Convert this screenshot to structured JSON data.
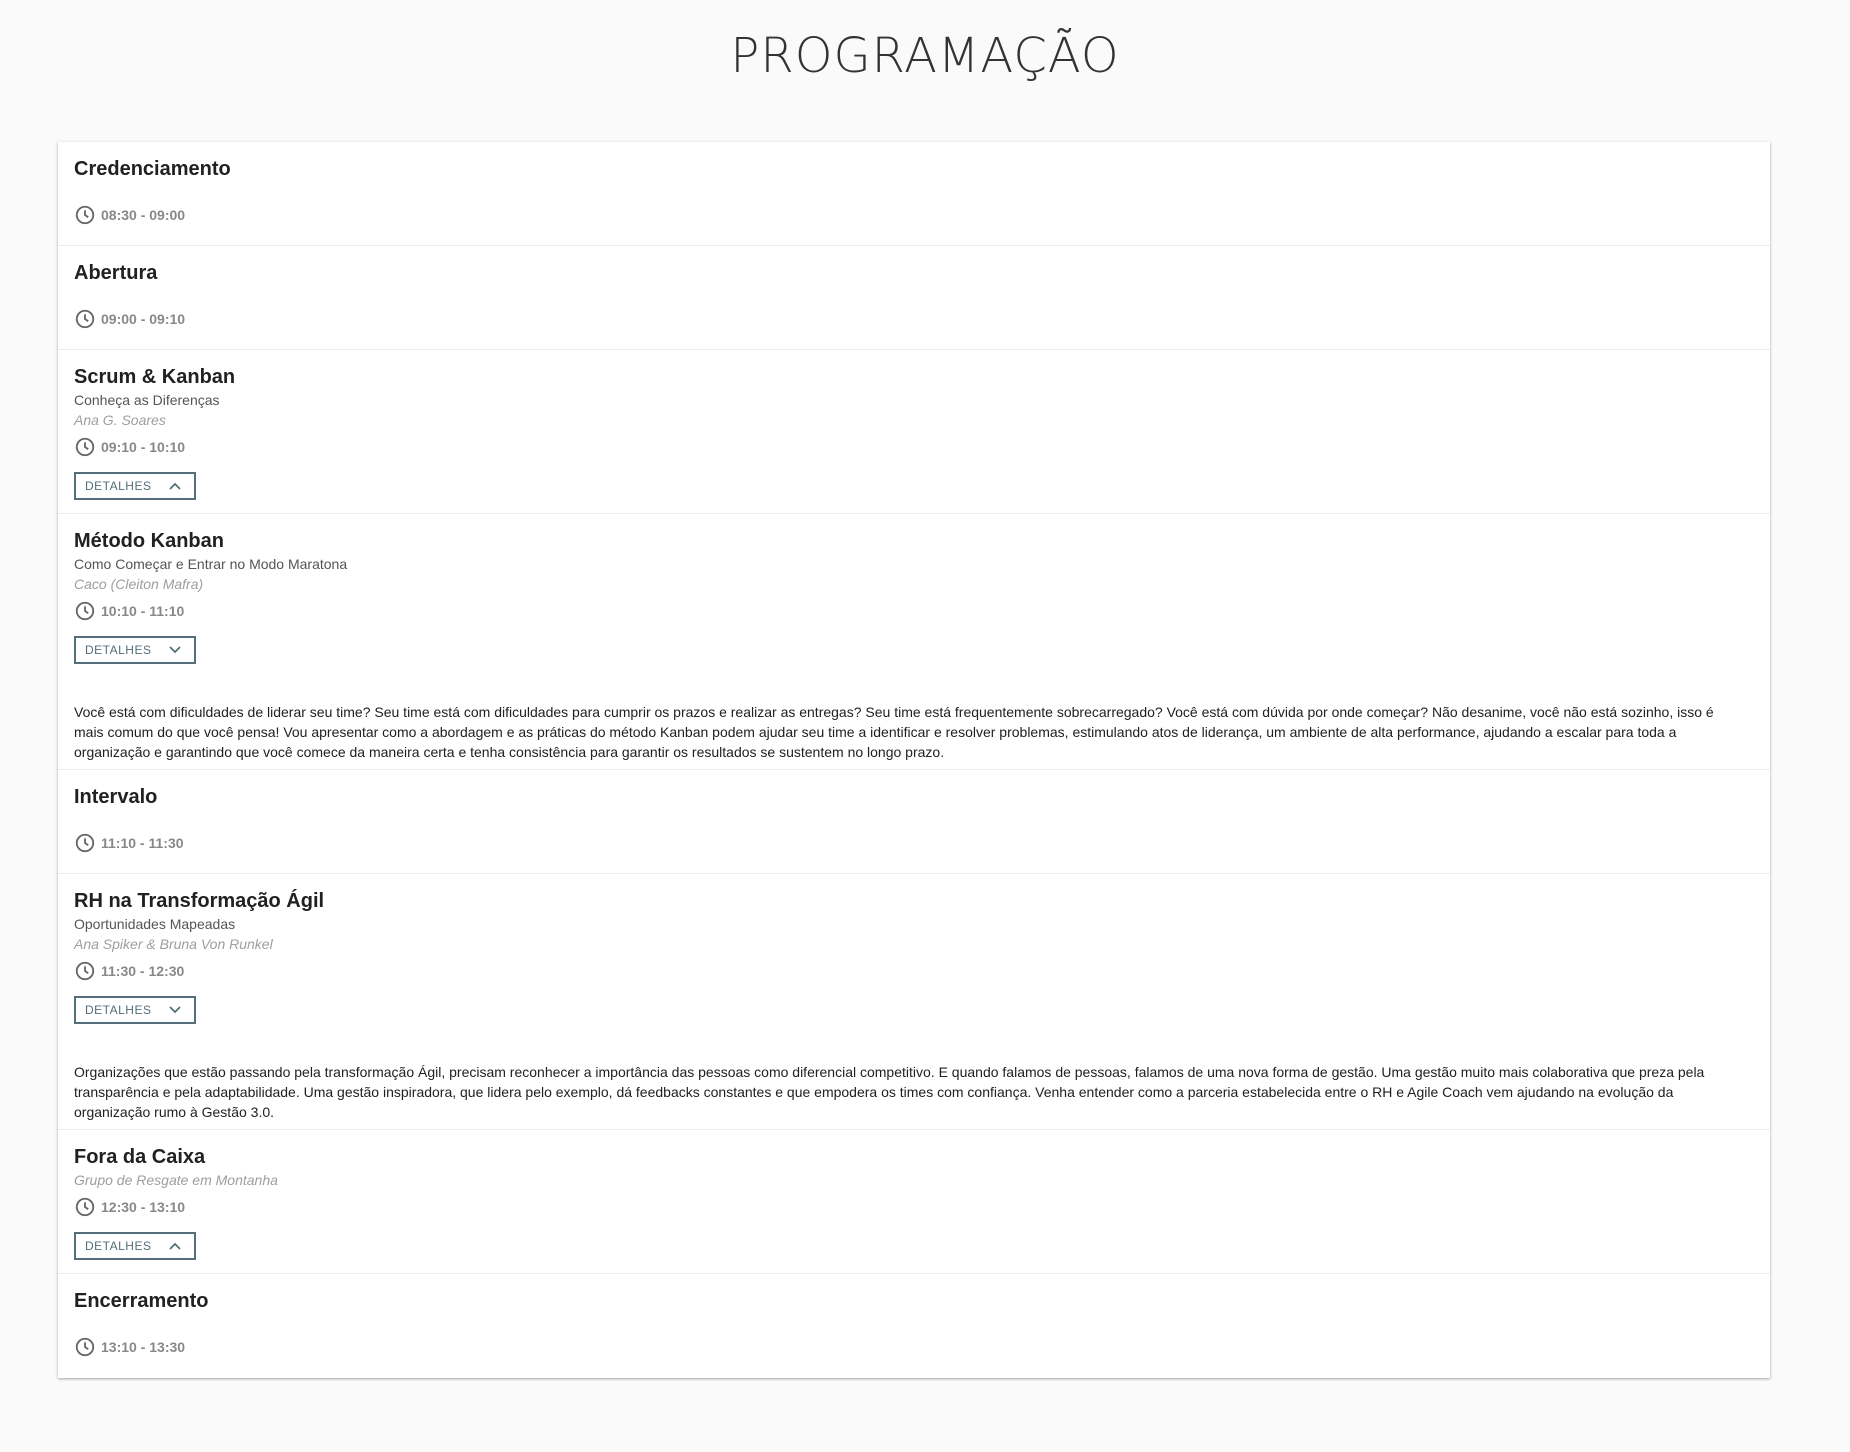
{
  "page": {
    "title": "PROGRAMAÇÃO"
  },
  "schedule": [
    {
      "title": "Credenciamento",
      "time": "08:30 - 09:00"
    },
    {
      "title": "Abertura",
      "time": "09:00 - 09:10"
    },
    {
      "title": "Scrum & Kanban",
      "subtitle": "Conheça as Diferenças",
      "speaker": "Ana G. Soares",
      "time": "09:10 - 10:10",
      "details_label": "DETALHES",
      "details_state": "expanded-icon-up"
    },
    {
      "title": "Método Kanban",
      "subtitle": "Como Começar e Entrar no Modo Maratona",
      "speaker": "Caco (Cleiton Mafra)",
      "time": "10:10 - 11:10",
      "details_label": "DETALHES",
      "details_state": "icon-down",
      "description": "Você está com dificuldades de liderar seu time? Seu time está com dificuldades para cumprir os prazos e realizar as entregas? Seu time está frequentemente sobrecarregado? Você está com dúvida por onde começar? Não desanime, você não está sozinho, isso é mais comum do que você pensa! Vou apresentar como a abordagem e as práticas do método Kanban podem ajudar seu time a identificar e resolver problemas, estimulando atos de liderança, um ambiente de alta performance, ajudando a escalar para toda a organização e garantindo que você comece da maneira certa e tenha consistência para garantir os resultados se sustentem no longo prazo."
    },
    {
      "title": "Intervalo",
      "time": "11:10 - 11:30"
    },
    {
      "title": "RH na Transformação Ágil",
      "subtitle": "Oportunidades Mapeadas",
      "speaker": "Ana Spiker & Bruna Von Runkel",
      "time": "11:30 - 12:30",
      "details_label": "DETALHES",
      "details_state": "icon-down",
      "description": "Organizações que estão passando pela transformação Ágil, precisam reconhecer a importância das pessoas como diferencial competitivo. E quando falamos de pessoas, falamos de uma nova forma de gestão. Uma gestão muito mais colaborativa que preza pela transparência e pela adaptabilidade. Uma gestão inspiradora, que lidera pelo exemplo, dá feedbacks constantes e que empodera os times com confiança. Venha entender como a parceria estabelecida entre o RH e Agile Coach vem ajudando na evolução da organização rumo à Gestão 3.0."
    },
    {
      "title": "Fora da Caixa",
      "speaker": "Grupo de Resgate em Montanha",
      "time": "12:30 - 13:10",
      "details_label": "DETALHES",
      "details_state": "expanded-icon-up"
    },
    {
      "title": "Encerramento",
      "time": "13:10 - 13:30"
    }
  ],
  "icons": {
    "clock": "clock-icon",
    "chevron_up": "chevron-up-icon",
    "chevron_down": "chevron-down-icon"
  },
  "colors": {
    "accent": "#546e7a",
    "time": "#888888",
    "speaker": "#9e9e9e",
    "background": "#fafafa"
  }
}
